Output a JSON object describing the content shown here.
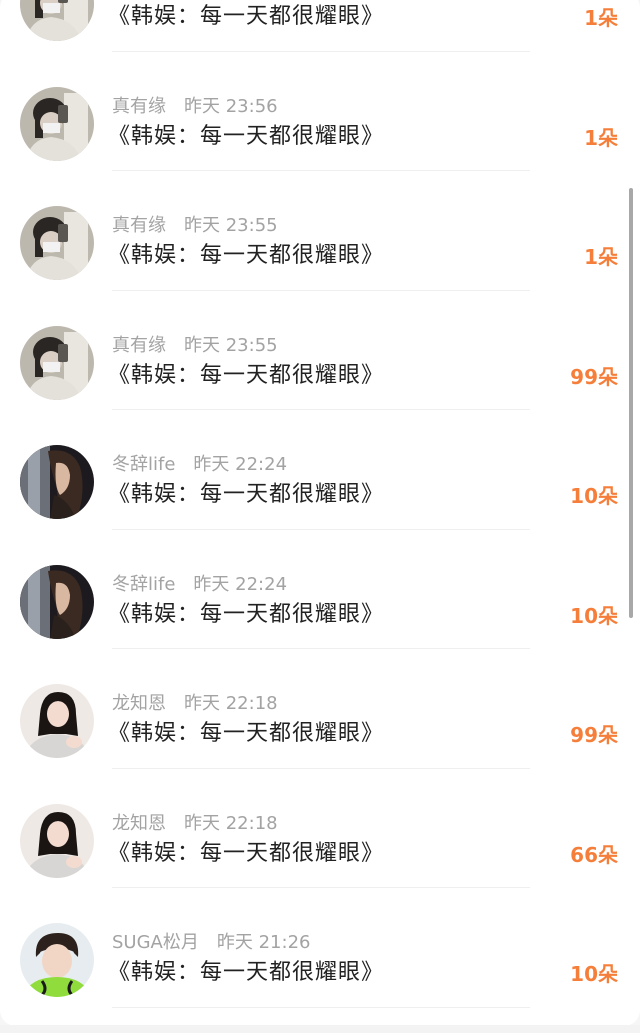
{
  "gifts": [
    {
      "name": "",
      "time": "",
      "title": "《韩娱：每一天都很耀眼》",
      "count": "1朵",
      "avatar_icon": "selfie-avatar-icon"
    },
    {
      "name": "真有缘",
      "time": "昨天 23:56",
      "title": "《韩娱：每一天都很耀眼》",
      "count": "1朵",
      "avatar_icon": "selfie-avatar-icon"
    },
    {
      "name": "真有缘",
      "time": "昨天 23:55",
      "title": "《韩娱：每一天都很耀眼》",
      "count": "1朵",
      "avatar_icon": "selfie-avatar-icon"
    },
    {
      "name": "真有缘",
      "time": "昨天 23:55",
      "title": "《韩娱：每一天都很耀眼》",
      "count": "99朵",
      "avatar_icon": "selfie-avatar-icon"
    },
    {
      "name": "冬辞life",
      "time": "昨天 22:24",
      "title": "《韩娱：每一天都很耀眼》",
      "count": "10朵",
      "avatar_icon": "profile-portrait-avatar-icon"
    },
    {
      "name": "冬辞life",
      "time": "昨天 22:24",
      "title": "《韩娱：每一天都很耀眼》",
      "count": "10朵",
      "avatar_icon": "profile-portrait-avatar-icon"
    },
    {
      "name": "龙知恩",
      "time": "昨天 22:18",
      "title": "《韩娱：每一天都很耀眼》",
      "count": "99朵",
      "avatar_icon": "girl-portrait-avatar-icon"
    },
    {
      "name": "龙知恩",
      "time": "昨天 22:18",
      "title": "《韩娱：每一天都很耀眼》",
      "count": "66朵",
      "avatar_icon": "girl-portrait-avatar-icon"
    },
    {
      "name": "SUGA松月",
      "time": "昨天 21:26",
      "title": "《韩娱：每一天都很耀眼》",
      "count": "10朵",
      "avatar_icon": "boy-portrait-avatar-icon"
    }
  ],
  "colors": {
    "count": "#f57f3a",
    "meta": "#a3a3a3",
    "title": "#222222"
  }
}
